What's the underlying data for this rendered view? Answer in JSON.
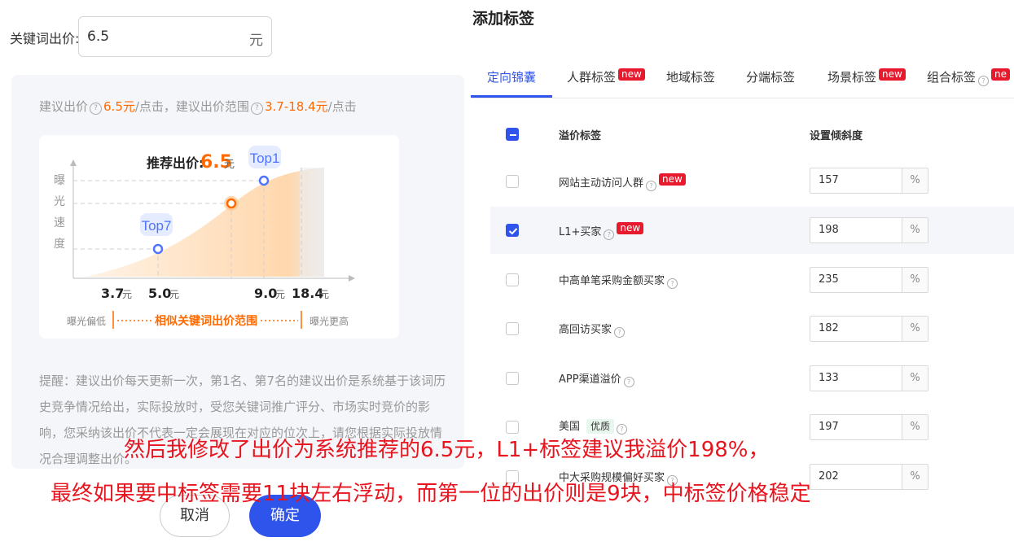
{
  "bid": {
    "label": "关键词出价:",
    "value": "6.5",
    "unit": "元"
  },
  "suggestion": {
    "prefix": "建议出价",
    "price": "6.5元",
    "per_click1": "/点击，建议出价范围",
    "range": "3.7-18.4元",
    "per_click2": "/点击"
  },
  "chart": {
    "ylabel_chars": [
      "曝",
      "光",
      "速",
      "度"
    ],
    "recommended_label": "推荐出价:",
    "recommended_value": "6.5",
    "recommended_unit": "元",
    "top1_label": "Top1",
    "top7_label": "Top7",
    "x_ticks": [
      {
        "num": "3.7",
        "unit": "元"
      },
      {
        "num": "5.0",
        "unit": "元"
      },
      {
        "num": "9.0",
        "unit": "元"
      },
      {
        "num": "18.4",
        "unit": "元"
      }
    ],
    "low_label": "曝光偏低",
    "range_label": "相似关键词出价范围",
    "high_label": "曝光更高",
    "colors": {
      "accent": "#ff6a00",
      "point": "#4f74ff"
    }
  },
  "tip": {
    "text": "提醒：建议出价每天更新一次，第1名、第7名的建议出价是系统基于该词历史竞争情况给出，实际投放时，受您关键词推广评分、市场实时竞价的影响，您采纳该出价不代表一定会展现在对应的位次上，请您根据实际投放情况合理调整出价。"
  },
  "buttons": {
    "cancel": "取消",
    "ok": "确定"
  },
  "right": {
    "title": "添加标签",
    "tabs": [
      {
        "label": "定向锦囊"
      },
      {
        "label": "人群标签",
        "badge": "new"
      },
      {
        "label": "地域标签"
      },
      {
        "label": "分端标签"
      },
      {
        "label": "场景标签",
        "badge": "new"
      },
      {
        "label": "组合标签",
        "badge": "ne"
      }
    ],
    "headers": {
      "name": "溢价标签",
      "slope": "设置倾斜度"
    },
    "rows": [
      {
        "name": "网站主动访问人群",
        "badge": "new",
        "value": "157",
        "unit": "%",
        "checked": false
      },
      {
        "name": "L1+买家",
        "badge": "new",
        "value": "198",
        "unit": "%",
        "checked": true
      },
      {
        "name": "中高单笔采购金额买家",
        "value": "235",
        "unit": "%",
        "checked": false
      },
      {
        "name": "高回访买家",
        "value": "182",
        "unit": "%",
        "checked": false
      },
      {
        "name": "APP渠道溢价",
        "value": "133",
        "unit": "%",
        "checked": false
      },
      {
        "name": "美国",
        "good": "优质",
        "value": "197",
        "unit": "%",
        "checked": false
      },
      {
        "name": "中大采购规模偏好买家",
        "value": "202",
        "unit": "%",
        "checked": false
      }
    ]
  },
  "caption": {
    "line1": "然后我修改了出价为系统推荐的6.5元，L1+标签建议我溢价198%，",
    "line2": "最终如果要中标签需要11块左右浮动，而第一位的出价则是9块，中标签价格稳定"
  }
}
